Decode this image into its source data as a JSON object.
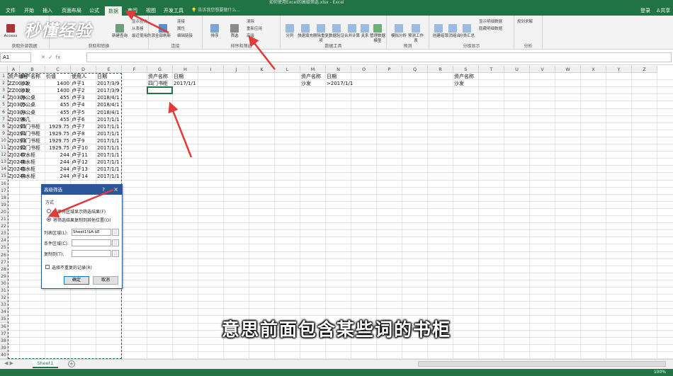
{
  "window": {
    "title": "如何使用Excel的高级筛选.xlsx - Excel"
  },
  "ribbon_tabs": [
    {
      "label": "文件"
    },
    {
      "label": "开始"
    },
    {
      "label": "插入"
    },
    {
      "label": "页面布局"
    },
    {
      "label": "公式"
    },
    {
      "label": "数据"
    },
    {
      "label": "审阅"
    },
    {
      "label": "视图"
    },
    {
      "label": "开发工具"
    }
  ],
  "active_tab": "数据",
  "tell_me": "告诉我您想要做什么...",
  "user": {
    "signin": "登录",
    "share": "共享"
  },
  "ribbon": {
    "groups": [
      {
        "label": "获取外部数据"
      },
      {
        "label": "获取和转换"
      },
      {
        "label": "连接"
      },
      {
        "label": "排序和筛选"
      },
      {
        "label": "数据工具"
      },
      {
        "label": "预测"
      },
      {
        "label": "分级显示"
      },
      {
        "label": "分析"
      }
    ],
    "buttons": {
      "access": "Access",
      "new_query": "新建查询",
      "refresh_all": "全部刷新",
      "sort": "排序",
      "filter": "筛选",
      "clear": "清除",
      "reapply": "重新应用",
      "advanced": "高级",
      "text_to_columns": "分列",
      "flash_fill": "快速填充",
      "remove_dup": "删除重复项",
      "data_validation": "数据验证",
      "consolidate": "合并计算",
      "relationships": "关系",
      "manage_model": "管理数据模型",
      "what_if": "模拟分析",
      "forecast_sheet": "预测工作表",
      "group": "创建组",
      "ungroup": "取消组合",
      "subtotal": "分类汇总",
      "show_detail": "显示明细数据",
      "hide_detail": "隐藏明细数据",
      "solver": "规划求解",
      "connections": "连接",
      "properties": "属性",
      "edit_links": "编辑链接",
      "show_query": "显示查询",
      "from_table": "从表格",
      "recent_sources": "最近使用的源"
    }
  },
  "formula_bar": {
    "name_box": "A1",
    "fx": "fx",
    "value": ""
  },
  "columns": [
    "A",
    "B",
    "C",
    "D",
    "E",
    "F",
    "G",
    "H",
    "I",
    "J",
    "K",
    "L",
    "M",
    "N",
    "O",
    "P",
    "Q",
    "R",
    "S",
    "T",
    "U",
    "V",
    "W",
    "X",
    "Y",
    "Z"
  ],
  "rows": [
    "1",
    "2",
    "3",
    "4",
    "5",
    "6",
    "7",
    "8",
    "9",
    "10",
    "11",
    "12",
    "13",
    "14",
    "15",
    "16",
    "17",
    "18",
    "19",
    "20",
    "21",
    "22",
    "23",
    "24",
    "25",
    "26",
    "27",
    "28",
    "29",
    "30",
    "31",
    "32",
    "33",
    "34",
    "35",
    "36",
    "37",
    "38",
    "39",
    "40"
  ],
  "table": {
    "headers": [
      "资产编号",
      "资产名称",
      "价值",
      "使用人",
      "日期"
    ],
    "rows": [
      [
        "ZZ0002",
        "沙发",
        "1400",
        "卢子1",
        "2017/3/9"
      ],
      [
        "ZZ0001",
        "沙发",
        "1400",
        "卢子2",
        "2017/3/9"
      ],
      [
        "ZJ0306",
        "办公桌",
        "455",
        "卢子3",
        "2018/4/1"
      ],
      [
        "ZJ0305",
        "办公桌",
        "455",
        "卢子4",
        "2018/4/1"
      ],
      [
        "ZJ0304",
        "办公桌",
        "455",
        "卢子5",
        "2018/4/1"
      ],
      [
        "ZJ0296",
        "茶几",
        "455",
        "卢子6",
        "2017/1/1"
      ],
      [
        "ZJ0295",
        "四门书柜",
        "1929.75",
        "卢子7",
        "2017/1/1"
      ],
      [
        "ZJ0294",
        "四门书柜",
        "1929.75",
        "卢子8",
        "2017/1/1"
      ],
      [
        "ZJ0293",
        "四门书柜",
        "1929.75",
        "卢子9",
        "2017/1/1"
      ],
      [
        "ZJ0292",
        "四门书柜",
        "1929.75",
        "卢子10",
        "2017/1/1"
      ],
      [
        "ZJ0247",
        "茶水柜",
        "244",
        "卢子11",
        "2017/1/1"
      ],
      [
        "ZJ0246",
        "茶水柜",
        "244",
        "卢子12",
        "2017/1/1"
      ],
      [
        "ZJ0245",
        "茶水柜",
        "244",
        "卢子13",
        "2017/1/1"
      ],
      [
        "ZJ0244",
        "茶水柜",
        "244",
        "卢子14",
        "2017/1/1"
      ]
    ]
  },
  "criteria_g": {
    "h1": "资产名称",
    "h2": "日期",
    "v1": "四门书柜",
    "v2": "2017/1/1"
  },
  "criteria_m": {
    "h1": "资产名称",
    "h2": "日期",
    "v1": "沙发",
    "v2": ">2017/1/1"
  },
  "criteria_s": {
    "h1": "资产名称",
    "v1": "沙发"
  },
  "dialog": {
    "title": "高级筛选",
    "help": "?",
    "close": "×",
    "section": "方式",
    "radio1": "在原有区域显示筛选结果(F)",
    "radio2": "将筛选结果复制到其他位置(O)",
    "list_label": "列表区域(L):",
    "list_value": "Sheet1!$A:$E",
    "criteria_label": "条件区域(C):",
    "criteria_value": "",
    "copy_label": "复制到(T):",
    "copy_value": "",
    "unique_label": "选择不重复的记录(R)",
    "ok": "确定",
    "cancel": "取消"
  },
  "sheet_tabs": [
    {
      "label": "Sheet1"
    }
  ],
  "add_sheet": "+",
  "zoom": "100%",
  "watermark": "秒懂经验",
  "subtitle": "意思前面包含某些词的书柜",
  "colors": {
    "excel_green": "#217346",
    "arrow_red": "#e03a3a",
    "dialog_blue": "#2b579a"
  }
}
